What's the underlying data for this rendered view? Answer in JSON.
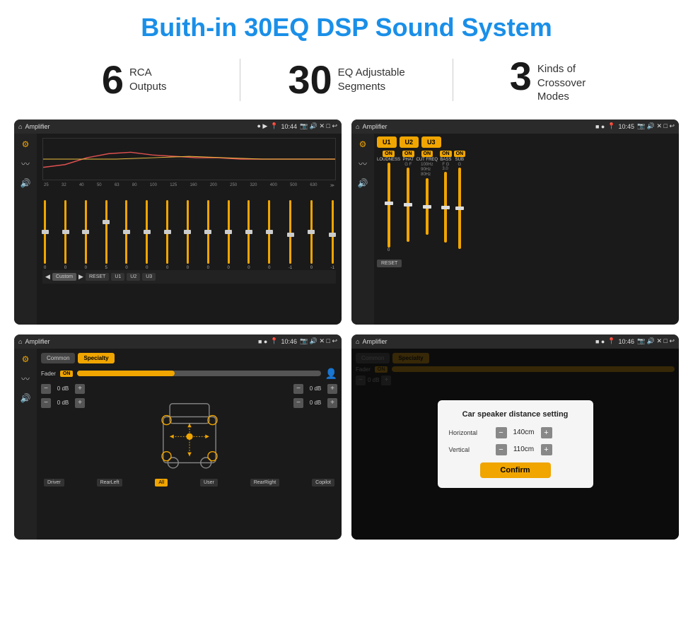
{
  "page": {
    "title": "Buith-in 30EQ DSP Sound System"
  },
  "stats": [
    {
      "number": "6",
      "label": "RCA\nOutputs"
    },
    {
      "number": "30",
      "label": "EQ Adjustable\nSegments"
    },
    {
      "number": "3",
      "label": "Kinds of\nCrossover Modes"
    }
  ],
  "screens": [
    {
      "id": "screen1",
      "status_time": "10:44",
      "title": "Amplifier",
      "description": "EQ Sliders Screen"
    },
    {
      "id": "screen2",
      "status_time": "10:45",
      "title": "Amplifier",
      "description": "Crossover Screen"
    },
    {
      "id": "screen3",
      "status_time": "10:46",
      "title": "Amplifier",
      "description": "Speaker Distance"
    },
    {
      "id": "screen4",
      "status_time": "10:46",
      "title": "Amplifier",
      "description": "Speaker Distance Dialog"
    }
  ],
  "eq": {
    "frequencies": [
      "25",
      "32",
      "40",
      "50",
      "63",
      "80",
      "100",
      "125",
      "160",
      "200",
      "250",
      "320",
      "400",
      "500",
      "630"
    ],
    "values": [
      "0",
      "0",
      "0",
      "5",
      "0",
      "0",
      "0",
      "0",
      "0",
      "0",
      "0",
      "0",
      "-1",
      "0",
      "-1"
    ],
    "preset": "Custom",
    "buttons": [
      "Custom",
      "RESET",
      "U1",
      "U2",
      "U3"
    ]
  },
  "crossover": {
    "channels": [
      "LOUDNESS",
      "PHAT",
      "CUT FREQ",
      "BASS",
      "SUB"
    ],
    "states": [
      "ON",
      "ON",
      "ON",
      "ON",
      "ON"
    ],
    "u_buttons": [
      "U1",
      "U2",
      "U3"
    ],
    "reset": "RESET"
  },
  "speaker": {
    "tabs": [
      "Common",
      "Specialty"
    ],
    "fader_label": "Fader",
    "fader_state": "ON",
    "volumes": [
      "0 dB",
      "0 dB",
      "0 dB",
      "0 dB"
    ],
    "bottom_buttons": [
      "Driver",
      "RearLeft",
      "All",
      "User",
      "RearRight",
      "Copilot"
    ]
  },
  "dialog": {
    "title": "Car speaker distance setting",
    "fields": [
      {
        "label": "Horizontal",
        "value": "140cm"
      },
      {
        "label": "Vertical",
        "value": "110cm"
      }
    ],
    "confirm_label": "Confirm"
  }
}
